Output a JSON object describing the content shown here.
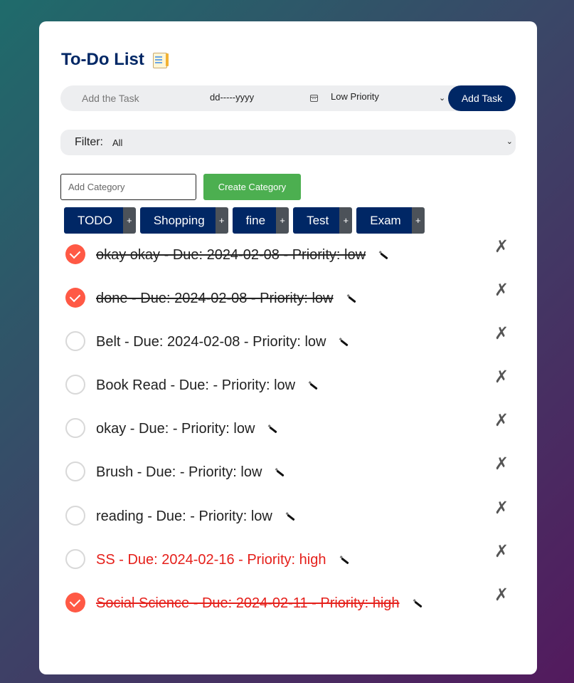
{
  "app": {
    "title": "To-Do List",
    "title_icon": "notepad-icon"
  },
  "add_task": {
    "task_placeholder": "Add the Task",
    "date_placeholder": "dd-----yyyy",
    "priority_selected": "Low Priority",
    "add_button_label": "Add Task"
  },
  "filter": {
    "label": "Filter:",
    "selected": "All"
  },
  "category": {
    "input_placeholder": "Add Category",
    "create_button_label": "Create Category",
    "plus_label": "+",
    "items": [
      {
        "name": "TODO"
      },
      {
        "name": "Shopping"
      },
      {
        "name": "fine"
      },
      {
        "name": "Test"
      },
      {
        "name": "Exam"
      }
    ]
  },
  "colors": {
    "accent": "#002765",
    "create": "#4caf50",
    "checked": "#ff5945",
    "high_priority": "#e5201b"
  },
  "delete_label": "✗",
  "tasks": [
    {
      "text": "okay okay - Due: 2024-02-08 - Priority: low",
      "done": true,
      "priority": "low"
    },
    {
      "text": "done - Due: 2024-02-08 - Priority: low",
      "done": true,
      "priority": "low"
    },
    {
      "text": "Belt - Due: 2024-02-08 - Priority: low",
      "done": false,
      "priority": "low"
    },
    {
      "text": "Book Read - Due: - Priority: low",
      "done": false,
      "priority": "low"
    },
    {
      "text": "okay - Due: - Priority: low",
      "done": false,
      "priority": "low"
    },
    {
      "text": "Brush - Due: - Priority: low",
      "done": false,
      "priority": "low"
    },
    {
      "text": "reading - Due: - Priority: low",
      "done": false,
      "priority": "low"
    },
    {
      "text": "SS - Due: 2024-02-16 - Priority: high",
      "done": false,
      "priority": "high"
    },
    {
      "text": "Social Science - Due: 2024-02-11 - Priority: high",
      "done": true,
      "priority": "high"
    }
  ]
}
